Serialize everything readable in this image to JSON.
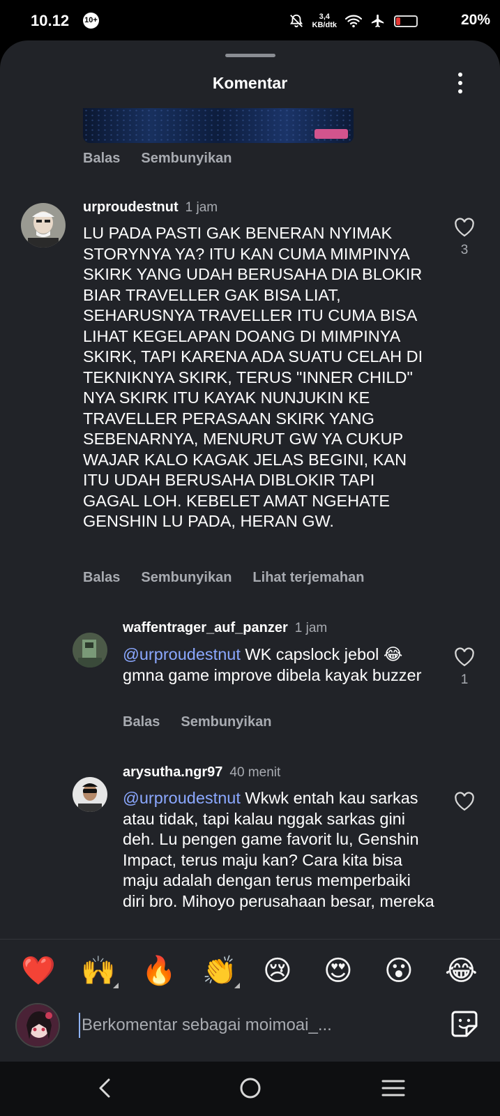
{
  "status_bar": {
    "time": "10.12",
    "notif_count": "10+",
    "net_speed_value": "3,4",
    "net_speed_unit": "KB/dtk",
    "battery": "20%",
    "battery_level": 0.2
  },
  "sheet": {
    "title": "Komentar"
  },
  "top_actions": {
    "reply": "Balas",
    "hide": "Sembunyikan"
  },
  "comments": [
    {
      "username": "urproudestnut",
      "time": "1 jam",
      "text": "LU PADA PASTI GAK BENERAN NYIMAK STORYNYA YA? ITU KAN CUMA MIMPINYA SKIRK YANG UDAH BERUSAHA DIA BLOKIR BIAR TRAVELLER GAK BISA LIAT, SEHARUSNYA TRAVELLER ITU CUMA BISA LIHAT KEGELAPAN DOANG DI MIMPINYA SKIRK, TAPI KARENA ADA SUATU CELAH DI TEKNIKNYA SKIRK, TERUS \"INNER CHILD\" NYA SKIRK ITU KAYAK NUNJUKIN KE TRAVELLER PERASAAN SKIRK YANG SEBENARNYA, MENURUT GW YA CUKUP WAJAR KALO KAGAK JELAS BEGINI, KAN ITU UDAH BERUSAHA DIBLOKIR TAPI GAGAL LOH. KEBELET AMAT NGEHATE GENSHIN LU PADA, HERAN GW.",
      "likes": "3",
      "reply": "Balas",
      "hide": "Sembunyikan",
      "translate": "Lihat terjemahan"
    },
    {
      "username": "waffentrager_auf_panzer",
      "time": "1 jam",
      "mention": "@urproudestnut",
      "text": " WK capslock jebol 😂 gmna game improve dibela kayak buzzer",
      "likes": "1",
      "reply": "Balas",
      "hide": "Sembunyikan"
    },
    {
      "username": "arysutha.ngr97",
      "time": "40 menit",
      "mention": "@urproudestnut",
      "text": " Wkwk entah kau sarkas atau tidak, tapi kalau nggak sarkas gini deh. Lu pengen game favorit lu, Genshin Impact, terus maju kan? Cara kita bisa maju adalah dengan terus memperbaiki diri bro. Mihoyo perusahaan besar, mereka"
    }
  ],
  "emoji_bar": [
    "❤️",
    "🙌",
    "🔥",
    "👏",
    "😢",
    "😍",
    "😮",
    "😂"
  ],
  "input": {
    "placeholder": "Berkomentar sebagai moimoai_..."
  },
  "icons": {
    "more": "more-vertical-icon",
    "like": "heart-outline-icon",
    "sticker": "sticker-icon",
    "back": "nav-back-icon",
    "home": "nav-home-icon",
    "recents": "nav-recents-icon"
  },
  "colors": {
    "sheet_bg": "#212328",
    "mention": "#8ba8ff",
    "secondary_text": "#a8abb1"
  }
}
